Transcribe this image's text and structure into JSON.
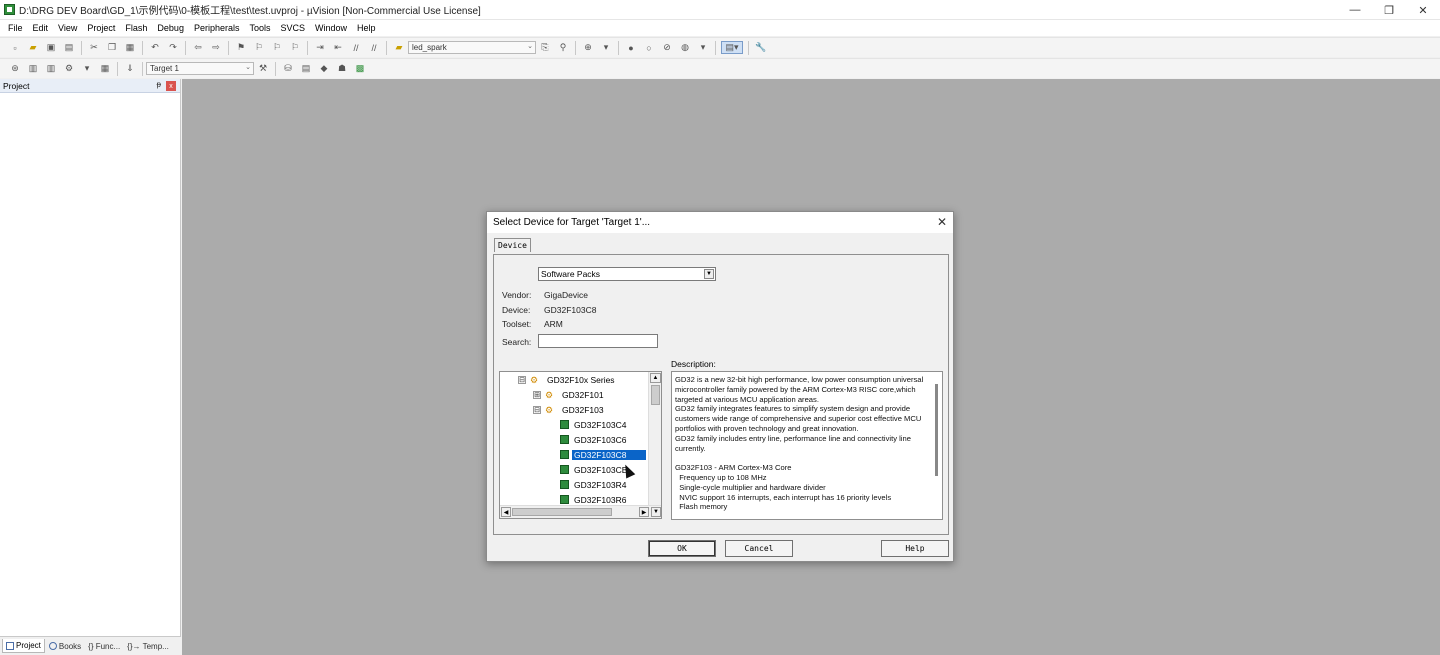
{
  "window": {
    "title": "D:\\DRG DEV Board\\GD_1\\示例代码\\0-模板工程\\test\\test.uvproj - µVision  [Non-Commercial Use License]",
    "controls": [
      "—",
      "❐",
      "✕"
    ]
  },
  "menu": [
    "File",
    "Edit",
    "View",
    "Project",
    "Flash",
    "Debug",
    "Peripherals",
    "Tools",
    "SVCS",
    "Window",
    "Help"
  ],
  "toolbar1": {
    "target_combo": "led_spark"
  },
  "toolbar2": {
    "target_combo": "Target 1"
  },
  "project_pane": {
    "title": "Project",
    "pin": "ᵽ",
    "close": "x",
    "tabs": [
      "Project",
      "Books",
      "{} Func...",
      "{}→ Temp..."
    ]
  },
  "dialog": {
    "title": "Select Device for Target 'Target 1'...",
    "close": "✕",
    "tab": "Device",
    "source_select": "Software Packs",
    "vendor_label": "Vendor:",
    "vendor": "GigaDevice",
    "device_label": "Device:",
    "device": "GD32F103C8",
    "toolset_label": "Toolset:",
    "toolset": "ARM",
    "search_label": "Search:",
    "search_value": "",
    "description_label": "Description:",
    "tree": [
      {
        "label": "GD32F10x Series",
        "exp": "⊟"
      },
      {
        "label": "GD32F101",
        "exp": "⊞"
      },
      {
        "label": "GD32F103",
        "exp": "⊟"
      },
      {
        "label": "GD32F103C4"
      },
      {
        "label": "GD32F103C6"
      },
      {
        "label": "GD32F103C8",
        "selected": true
      },
      {
        "label": "GD32F103CB"
      },
      {
        "label": "GD32F103R4"
      },
      {
        "label": "GD32F103R6"
      }
    ],
    "description": "GD32 is a new 32-bit high performance, low power consumption universal microcontroller family powered by the ARM Cortex-M3 RISC core,which targeted at various MCU application areas.\nGD32 family integrates features to simplify system design and provide customers wide range of comprehensive and superior cost effective MCU portfolios with proven technology and great innovation.\nGD32 family includes entry line, performance line and connectivity line currently.\n\nGD32F103 - ARM Cortex-M3 Core\n  Frequency up to 108 MHz\n  Single-cycle multiplier and hardware divider\n  NVIC support 16 interrupts, each interrupt has 16 priority levels\n  Flash memory",
    "buttons": {
      "ok": "OK",
      "cancel": "Cancel",
      "help": "Help"
    }
  }
}
